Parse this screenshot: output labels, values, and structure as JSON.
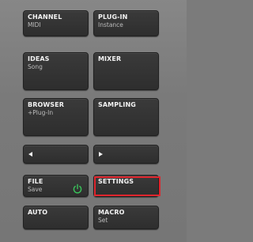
{
  "buttons": {
    "channel": {
      "label": "CHANNEL",
      "sub": "MIDI"
    },
    "plugin": {
      "label": "PLUG-IN",
      "sub": "Instance"
    },
    "ideas": {
      "label": "IDEAS",
      "sub": "Song"
    },
    "mixer": {
      "label": "MIXER"
    },
    "browser": {
      "label": "BROWSER",
      "sub": "+Plug-In"
    },
    "sampling": {
      "label": "SAMPLING"
    },
    "file": {
      "label": "FILE",
      "sub": "Save"
    },
    "settings": {
      "label": "SETTINGS"
    },
    "auto": {
      "label": "AUTO"
    },
    "macro": {
      "label": "MACRO",
      "sub": "Set"
    }
  },
  "icons": {
    "prev": "left-arrow-icon",
    "next": "right-arrow-icon",
    "file": "power-icon"
  },
  "colors": {
    "highlight": "#e0262e",
    "power_icon": "#39c45a",
    "button_bg": "#333333",
    "panel_bg": "#7b7b7b"
  }
}
